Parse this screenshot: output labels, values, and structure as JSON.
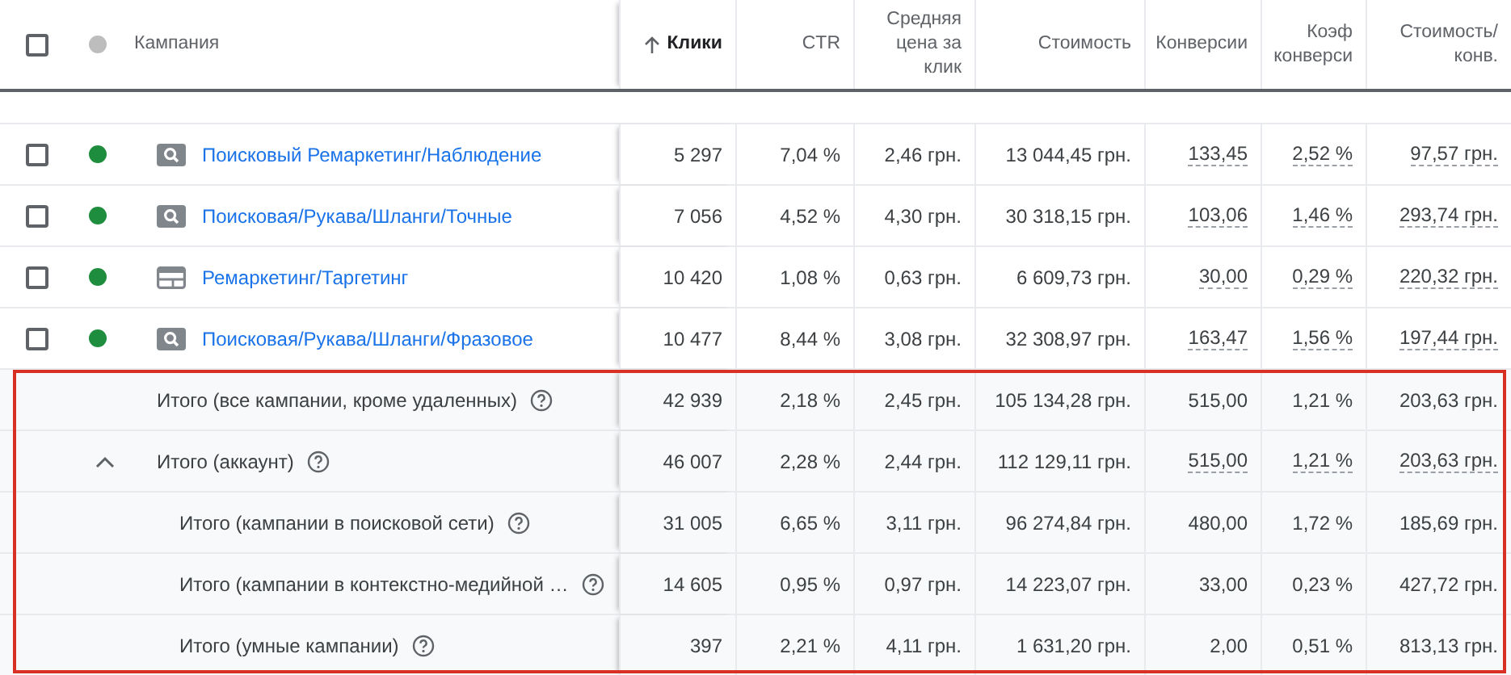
{
  "table": {
    "header": {
      "checked": false,
      "columns": [
        {
          "label": "Кампания",
          "sorted": false
        },
        {
          "label": "Клики",
          "sorted": true
        },
        {
          "label": "CTR",
          "sorted": false
        },
        {
          "label": "Средняя цена за клик",
          "sorted": false
        },
        {
          "label": "Стоимость",
          "sorted": false
        },
        {
          "label": "Конверсии",
          "sorted": false
        },
        {
          "label": "Коэф конверси",
          "sorted": false
        },
        {
          "label": "Стоимость/ конв.",
          "sorted": false
        }
      ]
    },
    "rows": [
      {
        "checked": false,
        "color": "#1e8e3e",
        "kind": "search",
        "name": "Поисковый Ремаркетинг/Наблюдение",
        "values": [
          "5 297",
          "7,04 %",
          "2,46 грн.",
          "13 044,45 грн.",
          "133,45",
          "2,52 %",
          "97,57 грн."
        ],
        "dashed": true
      },
      {
        "checked": false,
        "color": "#1e8e3e",
        "kind": "search",
        "name": "Поисковая/Рукава/Шланги/Точные",
        "values": [
          "7 056",
          "4,52 %",
          "4,30 грн.",
          "30 318,15 грн.",
          "103,06",
          "1,46 %",
          "293,74 грн."
        ],
        "dashed": true
      },
      {
        "checked": false,
        "color": "#1e8e3e",
        "kind": "display",
        "name": "Ремаркетинг/Таргетинг",
        "values": [
          "10 420",
          "1,08 %",
          "0,63 грн.",
          "6 609,73 грн.",
          "30,00",
          "0,29 %",
          "220,32 грн."
        ],
        "dashed": true
      },
      {
        "checked": false,
        "color": "#1e8e3e",
        "kind": "search",
        "name": "Поисковая/Рукава/Шланги/Фразовое",
        "values": [
          "10 477",
          "8,44 %",
          "3,08 грн.",
          "32 308,97 грн.",
          "163,47",
          "1,56 %",
          "197,44 грн."
        ],
        "dashed": true
      }
    ],
    "totals": [
      {
        "label": "Итого (все кампании, кроме удаленных)",
        "values": [
          "42 939",
          "2,18 %",
          "2,45 грн.",
          "105 134,28 грн.",
          "515,00",
          "1,21 %",
          "203,63 грн."
        ],
        "dashed": false
      },
      {
        "label": "Итого (аккаунт)",
        "expanded": true,
        "values": [
          "46 007",
          "2,28 %",
          "2,44 грн.",
          "112 129,11 грн.",
          "515,00",
          "1,21 %",
          "203,63 грн."
        ],
        "dashed": true,
        "children": [
          {
            "label": "Итого (кампании в поисковой сети)",
            "values": [
              "31 005",
              "6,65 %",
              "3,11 грн.",
              "96 274,84 грн.",
              "480,00",
              "1,72 %",
              "185,69 грн."
            ],
            "dashed": false
          },
          {
            "label": "Итого (кампании в контекстно-медийной …",
            "values": [
              "14 605",
              "0,95 %",
              "0,97 грн.",
              "14 223,07 грн.",
              "33,00",
              "0,23 %",
              "427,72 грн."
            ],
            "dashed": false
          },
          {
            "label": "Итого (умные кампании)",
            "values": [
              "397",
              "2,21 %",
              "4,11 грн.",
              "1 631,20 грн.",
              "2,00",
              "0,51 %",
              "813,13 грн."
            ],
            "dashed": false
          }
        ]
      }
    ]
  }
}
